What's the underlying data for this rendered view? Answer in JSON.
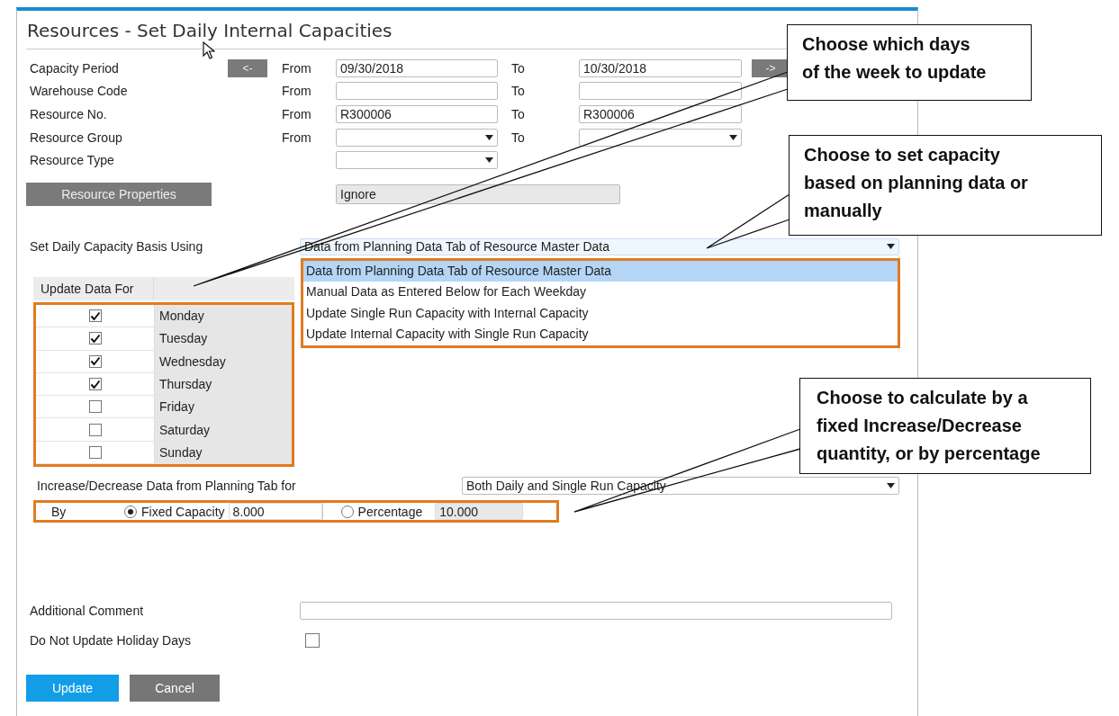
{
  "window": {
    "title": "Resources - Set Daily Internal Capacities"
  },
  "criteria": [
    {
      "label": "Capacity Period",
      "kind": "text",
      "prev_button": "<-",
      "from_label": "From",
      "from_value": "09/30/2018",
      "to_label": "To",
      "to_value": "10/30/2018",
      "next_button": "->"
    },
    {
      "label": "Warehouse Code",
      "kind": "text",
      "from_label": "From",
      "to_label": "To"
    },
    {
      "label": "Resource No.",
      "kind": "text",
      "from_label": "From",
      "from_value": "R300006",
      "to_label": "To",
      "to_value": "R300006"
    },
    {
      "label": "Resource Group",
      "kind": "dropdown",
      "from_label": "From",
      "to_label": "To"
    },
    {
      "label": "Resource Type",
      "kind": "dropdown"
    }
  ],
  "resource_properties": {
    "button": "Resource Properties",
    "value": "Ignore",
    "disabled": true
  },
  "capacity_basis": {
    "label": "Set Daily Capacity Basis Using",
    "value": "Data from Planning Data Tab of Resource Master Data",
    "expanded": true,
    "options": [
      {
        "label": "Data from Planning Data Tab of Resource Master Data",
        "selected": true
      },
      {
        "label": "Manual Data as Entered Below for Each Weekday",
        "selected": false
      },
      {
        "label": "Update Single Run Capacity with Internal Capacity",
        "selected": false
      },
      {
        "label": "Update Internal Capacity with Single Run Capacity",
        "selected": false
      }
    ]
  },
  "update_table": {
    "header": "Update Data For",
    "rows": [
      {
        "day": "Monday",
        "checked": true
      },
      {
        "day": "Tuesday",
        "checked": true
      },
      {
        "day": "Wednesday",
        "checked": true
      },
      {
        "day": "Thursday",
        "checked": true
      },
      {
        "day": "Friday",
        "checked": false
      },
      {
        "day": "Saturday",
        "checked": false
      },
      {
        "day": "Sunday",
        "checked": false
      }
    ]
  },
  "increase_decrease": {
    "label": "Increase/Decrease Data from Planning Tab for",
    "value": "Both Daily and Single Run Capacity"
  },
  "by": {
    "label": "By",
    "options": [
      {
        "label": "Fixed Capacity",
        "selected": true,
        "value": "8.000",
        "disabled": false
      },
      {
        "label": "Percentage",
        "selected": false,
        "value": "10.000",
        "disabled": true
      }
    ]
  },
  "additional_comment": {
    "label": "Additional Comment"
  },
  "holiday_days": {
    "label": "Do Not Update Holiday Days",
    "checked": false
  },
  "buttons": [
    {
      "label": "Update",
      "kind": "primary"
    },
    {
      "label": "Cancel",
      "kind": "secondary"
    }
  ],
  "callouts": [
    {
      "lines": [
        "Choose which days",
        "of the week to update"
      ]
    },
    {
      "lines": [
        "Choose to set capacity",
        "based on planning data or",
        "manually"
      ]
    },
    {
      "lines": [
        "Choose to calculate by a",
        "fixed Increase/Decrease",
        "quantity, or by percentage"
      ]
    }
  ]
}
